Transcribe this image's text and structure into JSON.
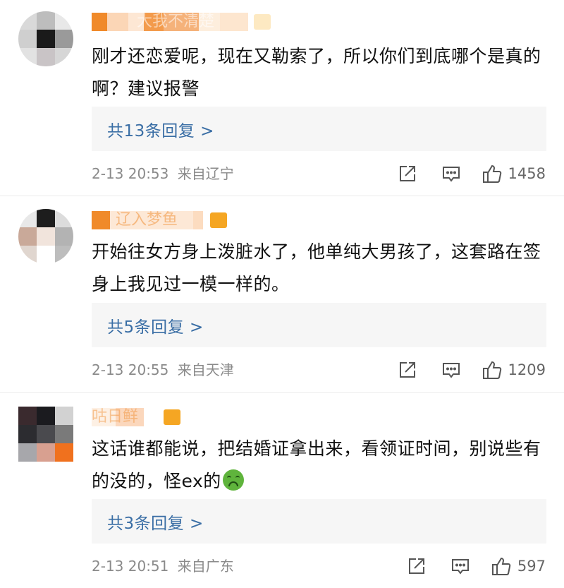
{
  "colors": {
    "reply_link": "#3a6ea5",
    "meta_text": "#8a8a8a",
    "reply_bg": "#f6f6f6",
    "username_mosaic": "#f08a2a",
    "badge": "#f5a623"
  },
  "comments": [
    {
      "username": "大我不清楚",
      "text": "刚才还恋爱呢，现在又勒索了，所以你们到底哪个是真的啊？建议报警",
      "reply_label": "共13条回复 >",
      "time": "2-13 20:53",
      "location": "来自辽宁",
      "likes": "1458",
      "icons": [
        "share-icon",
        "comment-icon",
        "thumbs-up-icon"
      ]
    },
    {
      "username": "辽入梦鱼",
      "text": "开始往女方身上泼脏水了，他单纯大男孩了，这套路在签身上我见过一模一样的。",
      "reply_label": "共5条回复 >",
      "time": "2-13 20:55",
      "location": "来自天津",
      "likes": "1209",
      "icons": [
        "share-icon",
        "comment-icon",
        "thumbs-up-icon"
      ]
    },
    {
      "username": "咕日鲜",
      "text": "这话谁都能说，把结婚证拿出来，看领证时间，别说些有的没的，怪ex的",
      "emoji": "nauseated-face-emoji",
      "reply_label": "共3条回复 >",
      "time": "2-13 20:51",
      "location": "来自广东",
      "likes": "597",
      "icons": [
        "share-icon",
        "comment-icon",
        "thumbs-up-icon"
      ]
    }
  ]
}
